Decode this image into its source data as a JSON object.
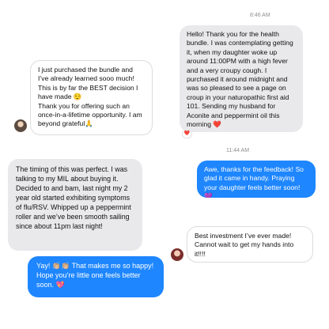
{
  "timestamps": [
    "8:46 AM",
    "11:44 AM"
  ],
  "messages": [
    {
      "text": "Hello! Thank you for the health bundle. I was contemplating getting it, when my daughter woke up around 11:00PM with a high fever and a very croupy cough. I purchased it around midnight and was so pleased to see a page on croup in your naturopathic first aid 101. Sending my husband for Aconite and peppermint oil this morning ❤️",
      "reaction": "❤️"
    },
    {
      "text": "I just purchased the bundle and I’ve already learned sooo much! This is by far the BEST decision I have made 😌\nThank you for offering such an once-in-a-lifetime opportunity. I am beyond grateful🙏"
    },
    {
      "text": "Awe, thanks for the feedback! So glad it came in handy. Praying your daughter feels better soon! 💜"
    },
    {
      "text": "The timing of this was perfect. I was talking to my MIL about buying it. Decided to and bam, last night my 2 year old started exhibiting symptoms of flu/RSV. Whipped up a peppermint roller and we’ve been smooth sailing since about 11pm last night!"
    },
    {
      "text": "Best investment I’ve ever made! Cannot wait to get my hands into it!!!!"
    },
    {
      "text": "Yay! 👏🏼👏🏼 That makes me so happy! Hope you’re little one feels better soon. 💖"
    }
  ]
}
